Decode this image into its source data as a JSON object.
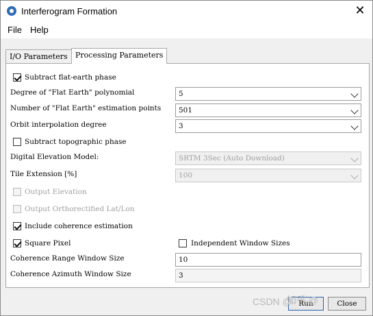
{
  "window": {
    "title": "Interferogram Formation",
    "icon": "app-logo-icon",
    "close_icon": "close-icon"
  },
  "menu": [
    "File",
    "Help"
  ],
  "tabs": [
    "I/O Parameters",
    "Processing Parameters"
  ],
  "form": {
    "subtract_flat_earth": {
      "label": "Subtract flat-earth phase",
      "checked": true
    },
    "degree_label": "Degree of \"Flat Earth\" polynomial",
    "degree_value": "5",
    "num_points_label": "Number of \"Flat Earth\" estimation points",
    "num_points_value": "501",
    "orbit_label": "Orbit interpolation degree",
    "orbit_value": "3",
    "subtract_topo": {
      "label": "Subtract topographic phase",
      "checked": false
    },
    "dem_label": "Digital Elevation Model:",
    "dem_value": "SRTM 3Sec (Auto Download)",
    "tile_label": "Tile Extension [%]",
    "tile_value": "100",
    "output_elevation": {
      "label": "Output Elevation",
      "checked": false,
      "enabled": false
    },
    "output_ortho": {
      "label": "Output Orthorectified Lat/Lon",
      "checked": false,
      "enabled": false
    },
    "include_coherence": {
      "label": "Include coherence estimation",
      "checked": true
    },
    "square_pixel": {
      "label": "Square Pixel",
      "checked": true
    },
    "independent_window": {
      "label": "Independent Window Sizes",
      "checked": false
    },
    "range_label": "Coherence Range Window Size",
    "range_value": "10",
    "azimuth_label": "Coherence Azimuth Window Size",
    "azimuth_value": "3"
  },
  "buttons": {
    "run": "Run",
    "close": "Close"
  },
  "watermark": {
    "left": "CSDN @",
    "right": "知乎 @"
  },
  "colors": {
    "accent": "#2a5fb0",
    "disabled_text": "#a0a0a0"
  }
}
